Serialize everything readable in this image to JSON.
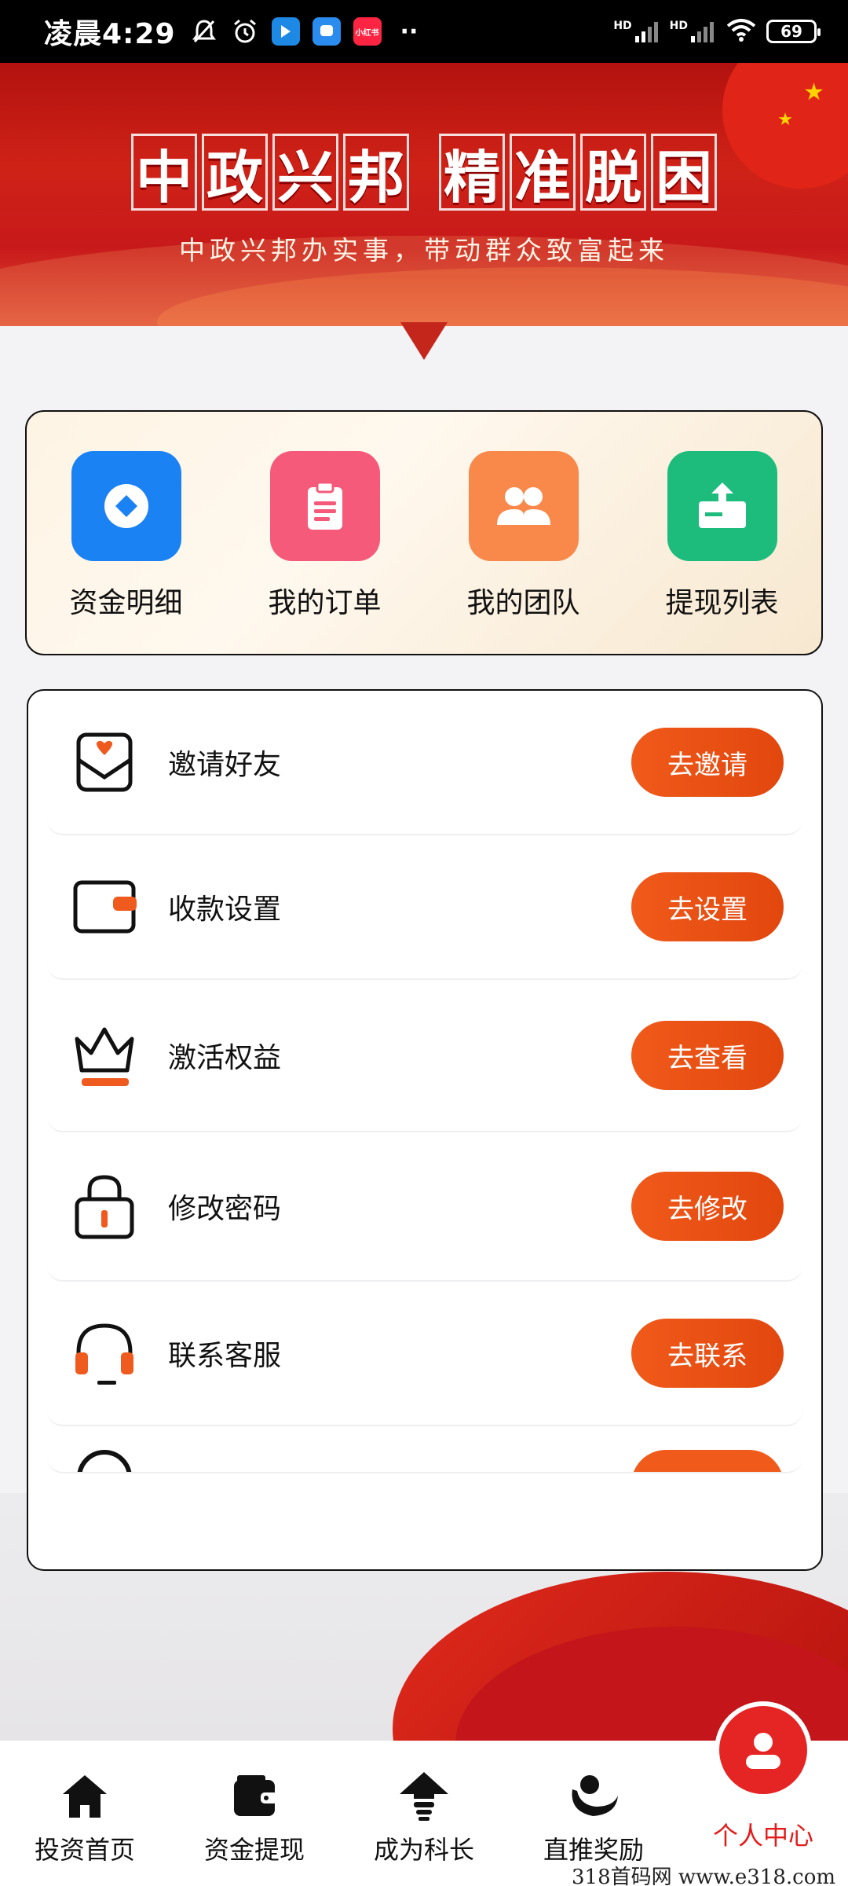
{
  "status_bar": {
    "time": "凌晨4:29",
    "icons": [
      "bell-off-icon",
      "alarm-icon",
      "app-icon-blue",
      "app-icon-chat",
      "app-icon-red"
    ],
    "app_red_label": "小红书",
    "dots": "··",
    "hd1": "HD",
    "hd2": "HD",
    "battery": "69"
  },
  "banner": {
    "title_chars_1": [
      "中",
      "政",
      "兴",
      "邦"
    ],
    "title_chars_2": [
      "精",
      "准",
      "脱",
      "困"
    ],
    "subtitle": "中政兴邦办实事，带动群众致富起来"
  },
  "quick_menu": [
    {
      "label": "资金明细",
      "icon": "diamond-icon",
      "color": "#1b82f3"
    },
    {
      "label": "我的订单",
      "icon": "clipboard-icon",
      "color": "#f55a7a"
    },
    {
      "label": "我的团队",
      "icon": "team-icon",
      "color": "#f8894a"
    },
    {
      "label": "提现列表",
      "icon": "withdraw-icon",
      "color": "#1dbb7c"
    }
  ],
  "list_rows": [
    {
      "label": "邀请好友",
      "button": "去邀请",
      "icon": "invite-envelope-icon"
    },
    {
      "label": "收款设置",
      "button": "去设置",
      "icon": "wallet-icon"
    },
    {
      "label": "激活权益",
      "button": "去查看",
      "icon": "crown-icon"
    },
    {
      "label": "修改密码",
      "button": "去修改",
      "icon": "lock-icon"
    },
    {
      "label": "联系客服",
      "button": "去联系",
      "icon": "headset-icon"
    }
  ],
  "tabs": [
    {
      "label": "投资首页",
      "icon": "home-icon"
    },
    {
      "label": "资金提现",
      "icon": "wallet-tab-icon"
    },
    {
      "label": "成为科长",
      "icon": "upgrade-arrow-icon"
    },
    {
      "label": "直推奖励",
      "icon": "reward-icon"
    },
    {
      "label": "个人中心",
      "icon": "user-icon",
      "active": true
    }
  ],
  "accent_color": "#f05a1a",
  "watermark": "318首码网   www.e318.com"
}
